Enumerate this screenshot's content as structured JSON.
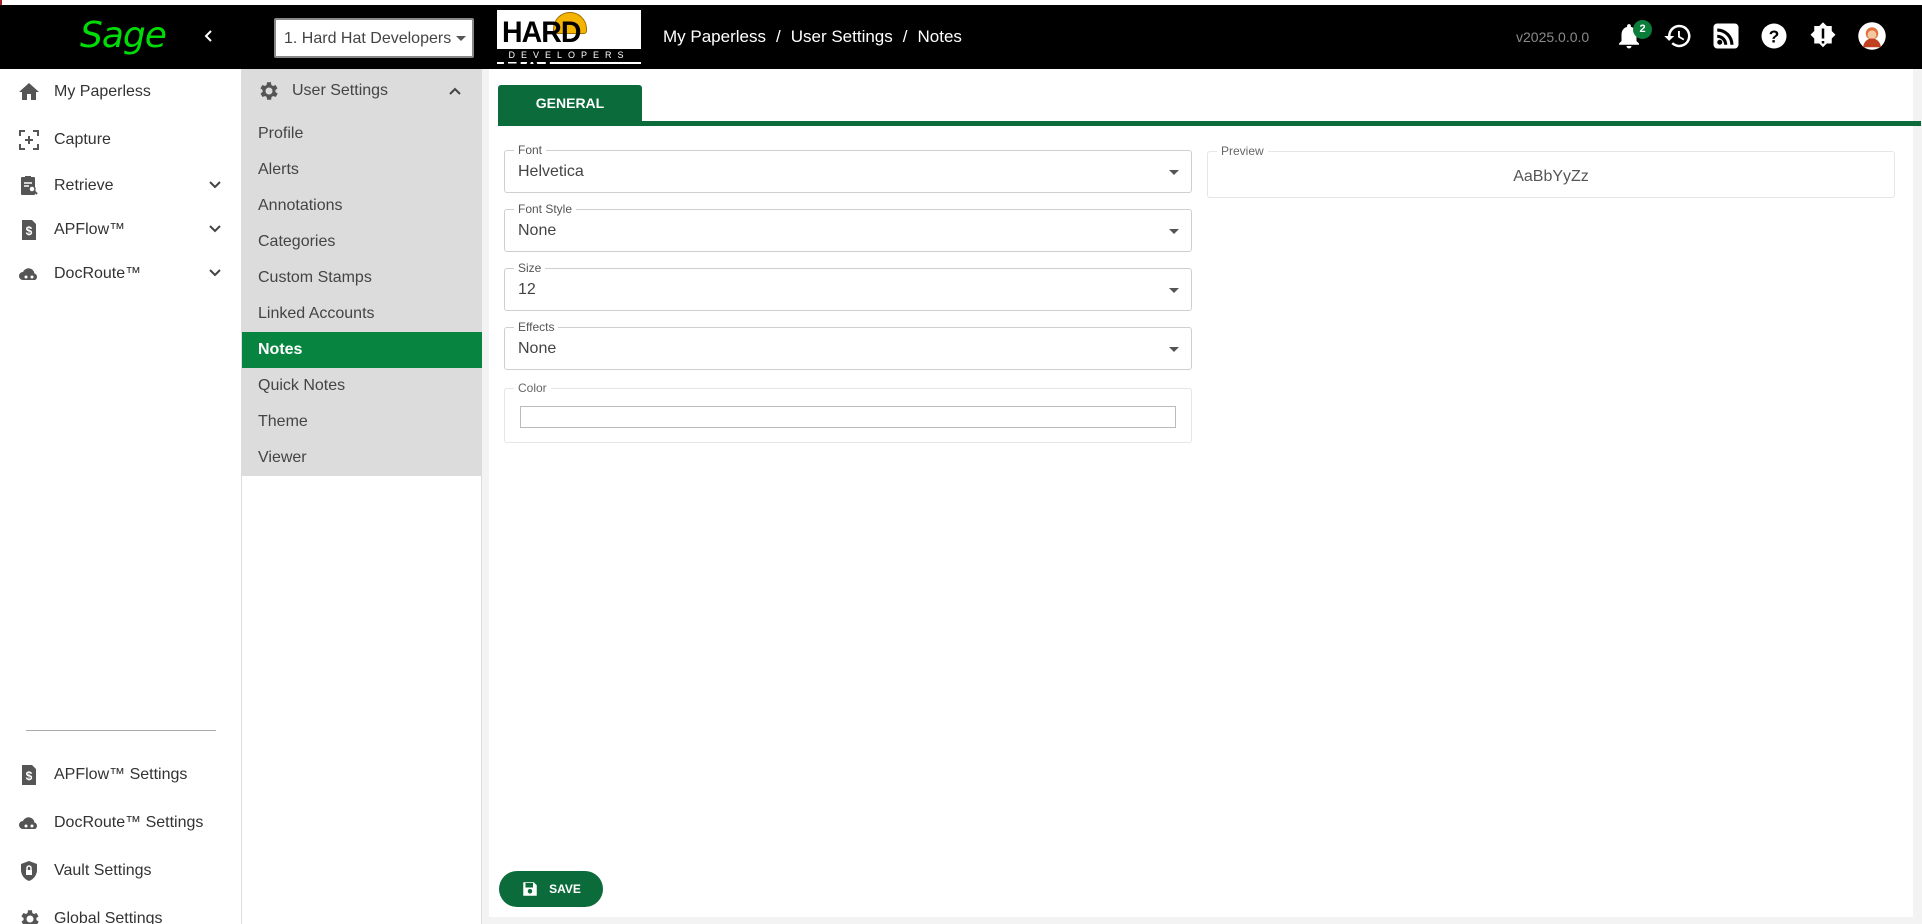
{
  "app": {
    "logo_text": "Sage",
    "version": "v2025.0.0.0",
    "notification_count": "2"
  },
  "company_selector": {
    "value": "1. Hard Hat Developers"
  },
  "brand": {
    "name": "HARD HAT",
    "tagline": "DEVELOPERS"
  },
  "breadcrumb": {
    "items": [
      "My Paperless",
      "User Settings",
      "Notes"
    ],
    "separator": "/"
  },
  "leftnav": {
    "top_items": [
      {
        "label": "My Paperless",
        "icon": "home-icon"
      },
      {
        "label": "Capture",
        "icon": "capture-icon"
      },
      {
        "label": "Retrieve",
        "icon": "clipboard-search-icon"
      },
      {
        "label": "APFlow™",
        "icon": "invoice-dollar-icon"
      },
      {
        "label": "DocRoute™",
        "icon": "cloud-route-icon"
      }
    ],
    "bottom_items": [
      {
        "label": "APFlow™ Settings",
        "icon": "invoice-dollar-icon"
      },
      {
        "label": "DocRoute™ Settings",
        "icon": "cloud-route-icon"
      },
      {
        "label": "Vault Settings",
        "icon": "shield-lock-icon"
      },
      {
        "label": "Global Settings",
        "icon": "gear-icon"
      }
    ]
  },
  "subnav": {
    "header": "User Settings",
    "items": [
      "Profile",
      "Alerts",
      "Annotations",
      "Categories",
      "Custom Stamps",
      "Linked Accounts",
      "Notes",
      "Quick Notes",
      "Theme",
      "Viewer"
    ],
    "active": "Notes"
  },
  "tabs": {
    "general": "GENERAL"
  },
  "form": {
    "font": {
      "label": "Font",
      "value": "Helvetica"
    },
    "font_style": {
      "label": "Font Style",
      "value": "None"
    },
    "size": {
      "label": "Size",
      "value": "12"
    },
    "effects": {
      "label": "Effects",
      "value": "None"
    },
    "color": {
      "label": "Color",
      "value": ""
    }
  },
  "preview": {
    "label": "Preview",
    "text": "AaBbYyZz"
  },
  "actions": {
    "save": "SAVE"
  },
  "colors": {
    "accent": "#0b6b3a",
    "active": "#078540",
    "brand_logo": "#00dc06"
  }
}
